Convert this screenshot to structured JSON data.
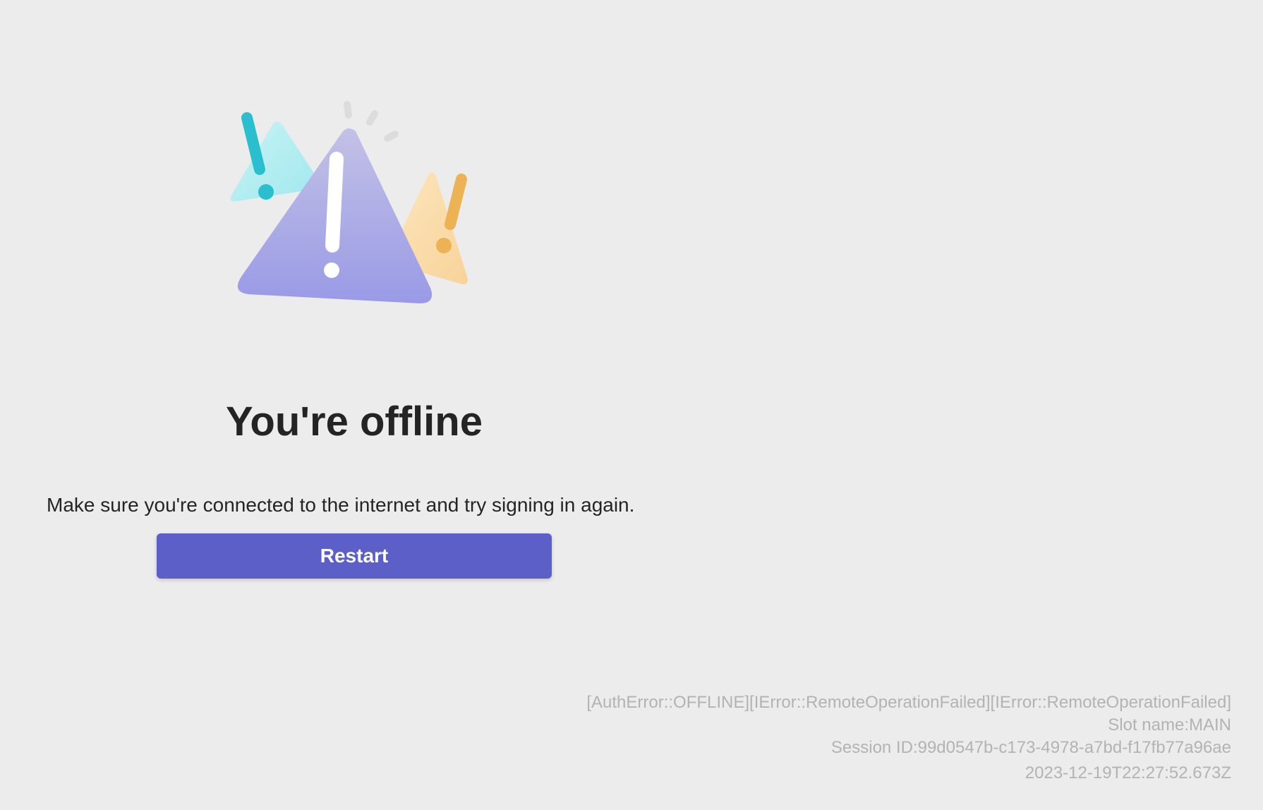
{
  "illustration": {
    "icon": "offline-warning-triangles-icon",
    "colors": {
      "main_triangle_top": "#bebde6",
      "main_triangle_bottom": "#9b9be6",
      "left_triangle": "#b6eff1",
      "left_mark": "#29bfcf",
      "right_triangle": "#fbdcaa",
      "right_mark": "#ecb254",
      "rays": "#dcdcdc"
    }
  },
  "title": "You're offline",
  "message": "Make sure you're connected to the internet and try signing in again.",
  "restart_button": {
    "label": "Restart",
    "color": "#5b5fc7"
  },
  "diagnostics": {
    "error_codes": "[AuthError::OFFLINE][IError::RemoteOperationFailed][IError::RemoteOperationFailed]",
    "slot_name": "Slot name:MAIN",
    "session_id": "Session ID:99d0547b-c173-4978-a7bd-f17fb77a96ae",
    "timestamp": "2023-12-19T22:27:52.673Z"
  },
  "background_color": "#ececec"
}
